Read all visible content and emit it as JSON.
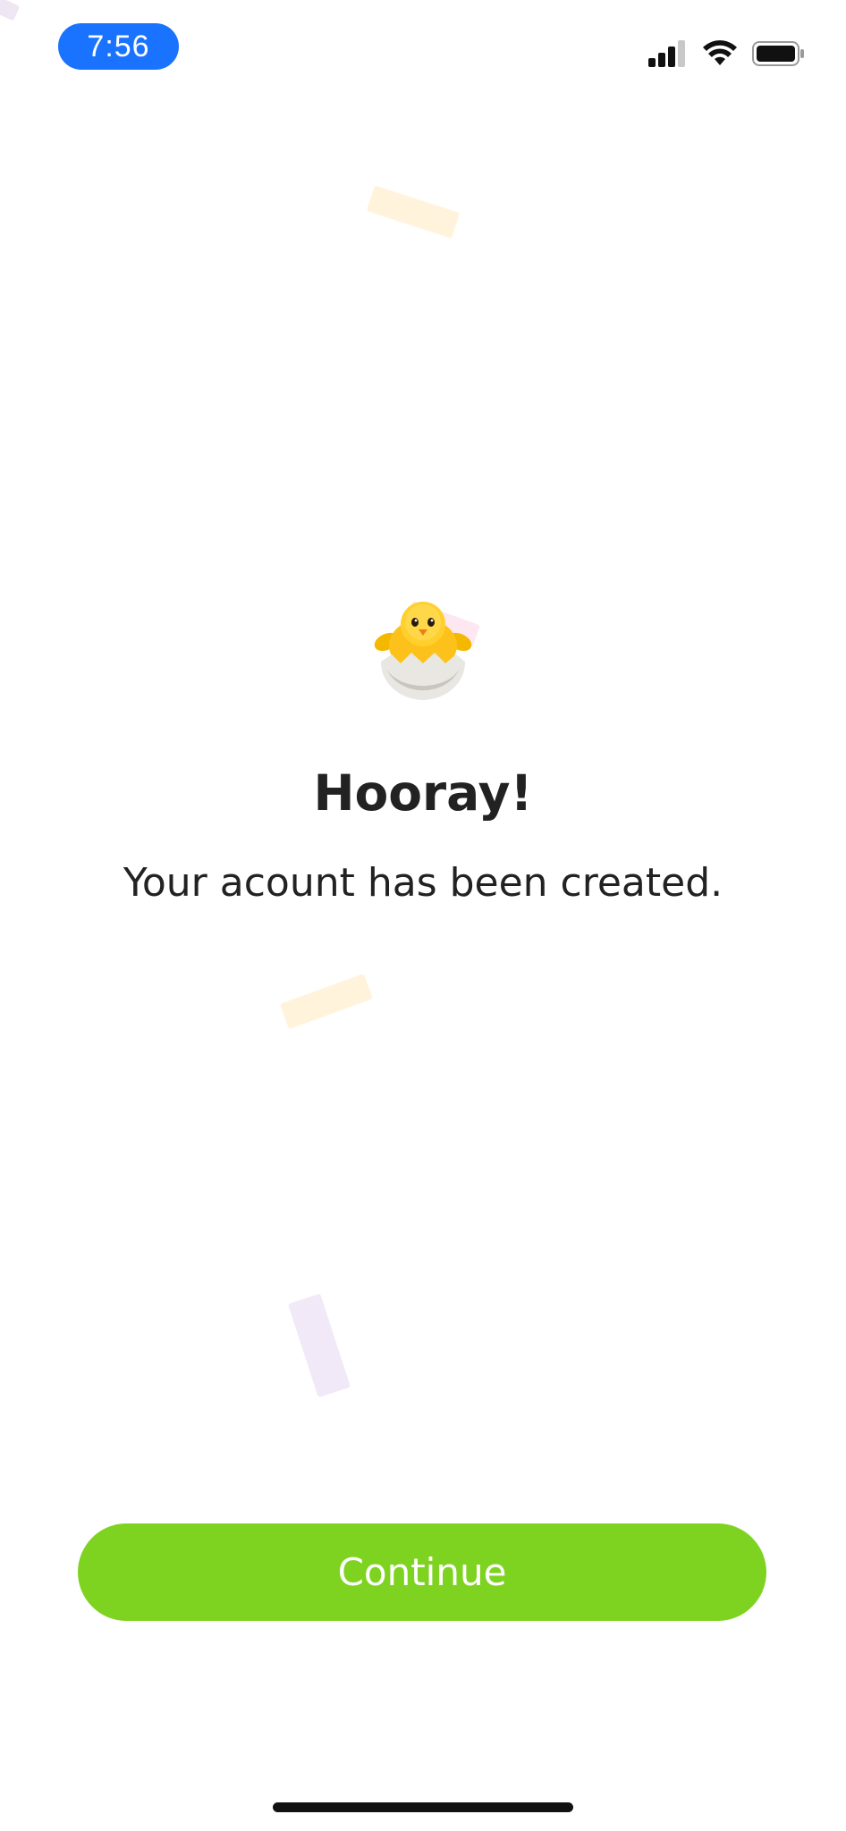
{
  "status_bar": {
    "time": "7:56",
    "time_pill_color": "#1a73ff",
    "icons": [
      "cellular-signal-icon",
      "wifi-icon",
      "battery-icon"
    ]
  },
  "main": {
    "emoji": "hatching-chick",
    "title": "Hooray!",
    "subtitle": "Your acount has been created."
  },
  "actions": {
    "continue_label": "Continue",
    "continue_color": "#7ed321"
  }
}
